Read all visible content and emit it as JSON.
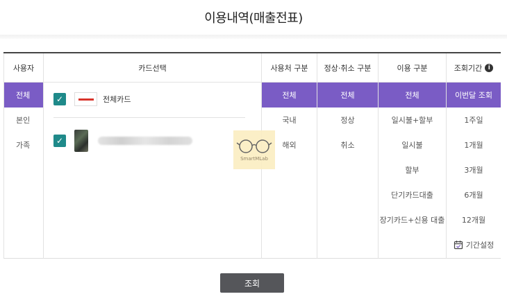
{
  "page": {
    "title": "이용내역(매출전표)"
  },
  "columns": {
    "user": {
      "header": "사용자",
      "options": [
        "전체",
        "본인",
        "가족"
      ],
      "selected": 0
    },
    "card": {
      "header": "카드선택",
      "items": [
        {
          "name": "전체카드",
          "checked": true,
          "logo_icon": "card-company-logo"
        },
        {
          "name": "",
          "checked": true,
          "blurred": true
        }
      ]
    },
    "location": {
      "header": "사용처 구분",
      "options": [
        "전체",
        "국내",
        "해외"
      ],
      "selected": 0
    },
    "type": {
      "header": "정상·취소 구분",
      "options": [
        "전체",
        "정상",
        "취소"
      ],
      "selected": 0
    },
    "usage": {
      "header": "이용 구분",
      "options": [
        "전체",
        "일시불+할부",
        "일시불",
        "할부",
        "단기카드대출",
        "장기카드+신용 대출"
      ],
      "selected": 0
    },
    "period": {
      "header": "조회기간",
      "options": [
        "이번달 조회",
        "1주일",
        "1개월",
        "3개월",
        "6개월",
        "12개월"
      ],
      "selected": 0,
      "custom_label": "기간설정"
    }
  },
  "watermark": {
    "text": "SmartMLab"
  },
  "actions": {
    "submit_label": "조회"
  },
  "colors": {
    "accent": "#7a5cc5",
    "checkbox": "#1f8a8a",
    "button": "#55565a"
  }
}
